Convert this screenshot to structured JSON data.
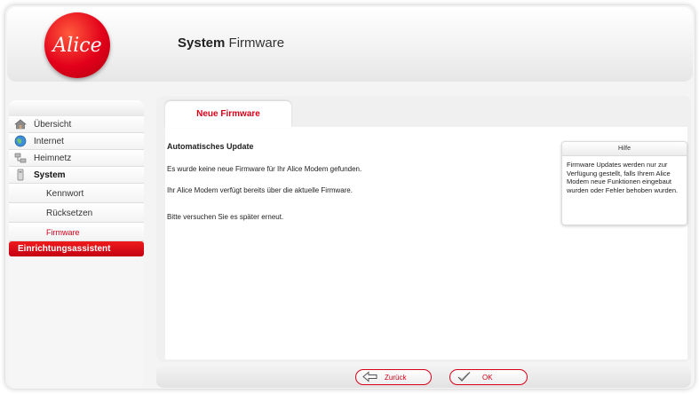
{
  "header": {
    "logo_text": "Alice",
    "title_bold": "System",
    "title_rest": "Firmware"
  },
  "sidebar": {
    "items": [
      {
        "label": "Übersicht",
        "icon": "home-icon"
      },
      {
        "label": "Internet",
        "icon": "globe-icon"
      },
      {
        "label": "Heimnetz",
        "icon": "network-icon"
      },
      {
        "label": "System",
        "icon": "device-icon"
      },
      {
        "label": "Kennwort"
      },
      {
        "label": "Rücksetzen"
      },
      {
        "label": "Firmware"
      }
    ],
    "assistant_label": "Einrichtungsassistent"
  },
  "main": {
    "tab_label": "Neue Firmware",
    "section_title": "Automatisches Update",
    "messages": [
      "Es wurde keine neue Firmware für Ihr Alice Modem gefunden.",
      "Ihr Alice Modem verfügt bereits über die aktuelle Firmware.",
      "Bitte versuchen Sie es später erneut."
    ]
  },
  "help": {
    "title": "Hilfe",
    "text": "Firmware Updates werden nur zur Verfügung gestellt, falls Ihrem Alice Modem neue Funktionen eingebaut wurden oder Fehler behoben wurden."
  },
  "footer": {
    "back_label": "Zurück",
    "ok_label": "OK"
  },
  "colors": {
    "accent": "#d90019",
    "background": "#f4f4f4"
  }
}
